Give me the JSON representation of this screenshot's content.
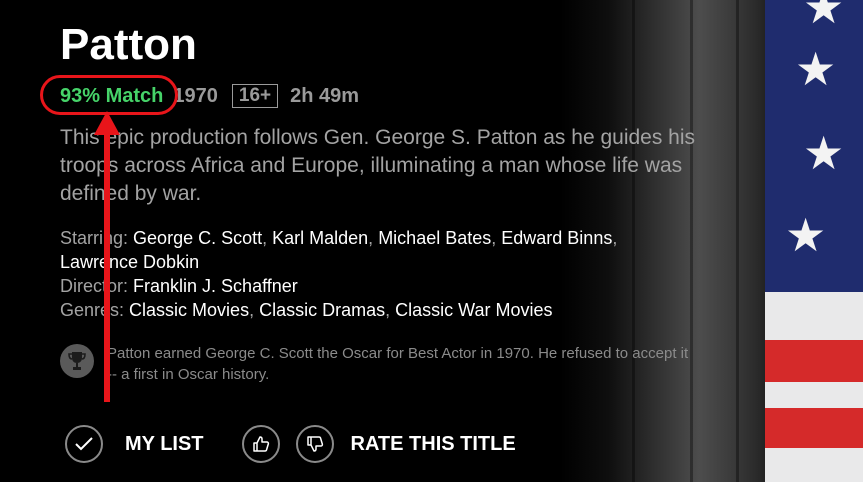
{
  "title": "Patton",
  "meta": {
    "match": "93% Match",
    "year": "1970",
    "maturity_rating": "16+",
    "runtime": "2h 49m"
  },
  "synopsis": "This epic production follows Gen. George S. Patton as he guides his troops across Africa and Europe, illuminating a man whose life was defined by war.",
  "credits": {
    "starring_label": "Starring:",
    "cast": [
      "George C. Scott",
      "Karl Malden",
      "Michael Bates",
      "Edward Binns",
      "Lawrence Dobkin"
    ],
    "director_label": "Director:",
    "director": "Franklin J. Schaffner",
    "genres_label": "Genres:",
    "genres": [
      "Classic Movies",
      "Classic Dramas",
      "Classic War Movies"
    ]
  },
  "trivia": "Patton earned George C. Scott the Oscar for Best Actor in 1970. He refused to accept it -- a first in Oscar history.",
  "actions": {
    "my_list": "MY LIST",
    "rate_title": "RATE THIS TITLE"
  },
  "icons": [
    "check-icon",
    "thumbs-up-icon",
    "thumbs-down-icon",
    "trophy-icon",
    "star-icon"
  ],
  "colors": {
    "match_green": "#46d369",
    "annotation_red": "#e8151a",
    "background": "#000000"
  }
}
